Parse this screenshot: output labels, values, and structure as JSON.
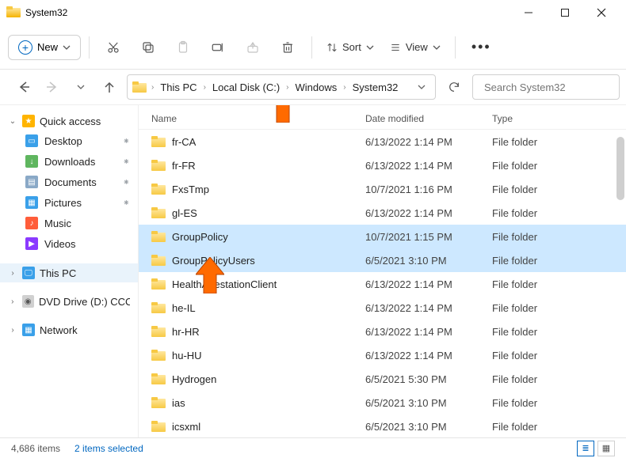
{
  "window": {
    "title": "System32"
  },
  "toolbar": {
    "new_label": "New",
    "sort_label": "Sort",
    "view_label": "View"
  },
  "breadcrumb": {
    "segments": [
      "This PC",
      "Local Disk (C:)",
      "Windows",
      "System32"
    ]
  },
  "search": {
    "placeholder": "Search System32"
  },
  "sidebar": {
    "quick_access": "Quick access",
    "items": [
      {
        "label": "Desktop",
        "pinned": true
      },
      {
        "label": "Downloads",
        "pinned": true
      },
      {
        "label": "Documents",
        "pinned": true
      },
      {
        "label": "Pictures",
        "pinned": true
      },
      {
        "label": "Music"
      },
      {
        "label": "Videos"
      }
    ],
    "this_pc": "This PC",
    "dvd": "DVD Drive (D:) CCCC",
    "network": "Network"
  },
  "columns": {
    "name": "Name",
    "date": "Date modified",
    "type": "Type"
  },
  "rows": [
    {
      "name": "fr-CA",
      "date": "6/13/2022 1:14 PM",
      "type": "File folder",
      "selected": false
    },
    {
      "name": "fr-FR",
      "date": "6/13/2022 1:14 PM",
      "type": "File folder",
      "selected": false
    },
    {
      "name": "FxsTmp",
      "date": "10/7/2021 1:16 PM",
      "type": "File folder",
      "selected": false
    },
    {
      "name": "gl-ES",
      "date": "6/13/2022 1:14 PM",
      "type": "File folder",
      "selected": false
    },
    {
      "name": "GroupPolicy",
      "date": "10/7/2021 1:15 PM",
      "type": "File folder",
      "selected": true
    },
    {
      "name": "GroupPolicyUsers",
      "date": "6/5/2021 3:10 PM",
      "type": "File folder",
      "selected": true
    },
    {
      "name": "HealthAttestationClient",
      "date": "6/13/2022 1:14 PM",
      "type": "File folder",
      "selected": false
    },
    {
      "name": "he-IL",
      "date": "6/13/2022 1:14 PM",
      "type": "File folder",
      "selected": false
    },
    {
      "name": "hr-HR",
      "date": "6/13/2022 1:14 PM",
      "type": "File folder",
      "selected": false
    },
    {
      "name": "hu-HU",
      "date": "6/13/2022 1:14 PM",
      "type": "File folder",
      "selected": false
    },
    {
      "name": "Hydrogen",
      "date": "6/5/2021 5:30 PM",
      "type": "File folder",
      "selected": false
    },
    {
      "name": "ias",
      "date": "6/5/2021 3:10 PM",
      "type": "File folder",
      "selected": false
    },
    {
      "name": "icsxml",
      "date": "6/5/2021 3:10 PM",
      "type": "File folder",
      "selected": false
    }
  ],
  "status": {
    "count": "4,686 items",
    "selected": "2 items selected"
  }
}
